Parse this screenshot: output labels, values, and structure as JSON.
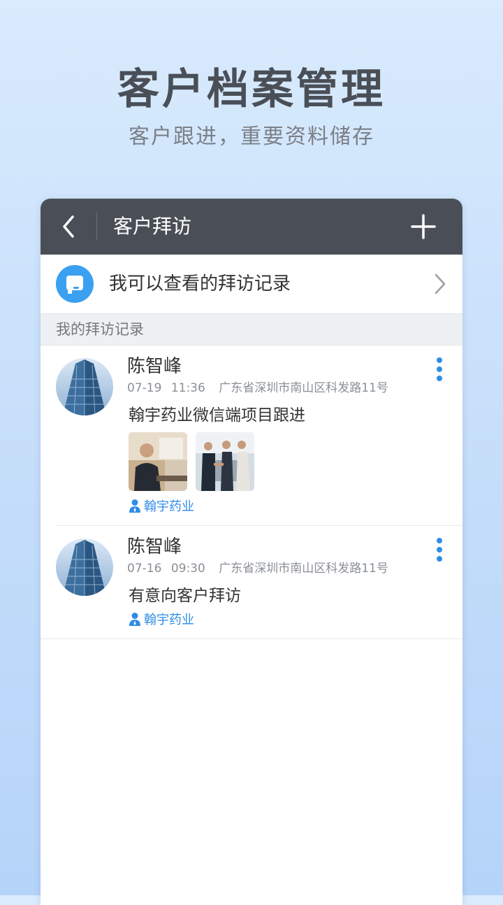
{
  "hero": {
    "title": "客户档案管理",
    "subtitle": "客户跟进，重要资料储存"
  },
  "topbar": {
    "title": "客户拜访",
    "back_icon": "chevron-left-icon",
    "add_icon": "plus-icon",
    "background": "#4a4f57"
  },
  "view_records": {
    "label": "我可以查看的拜访记录",
    "icon": "chat-bubble-icon",
    "icon_color": "#3ba0f0"
  },
  "section_header": "我的拜访记录",
  "records": [
    {
      "name": "陈智峰",
      "date": "07-19",
      "time": "11:36",
      "address": "广东省深圳市南山区科发路11号",
      "content": "翰宇药业微信端项目跟进",
      "company": "翰宇药业",
      "photos": [
        "office-meeting-photo",
        "handshake-photo"
      ]
    },
    {
      "name": "陈智峰",
      "date": "07-16",
      "time": "09:30",
      "address": "广东省深圳市南山区科发路11号",
      "content": "有意向客户拜访",
      "company": "翰宇药业",
      "photos": []
    }
  ],
  "colors": {
    "accent": "#2f8de6",
    "text_primary": "#333333",
    "text_secondary": "#8a8f96"
  }
}
